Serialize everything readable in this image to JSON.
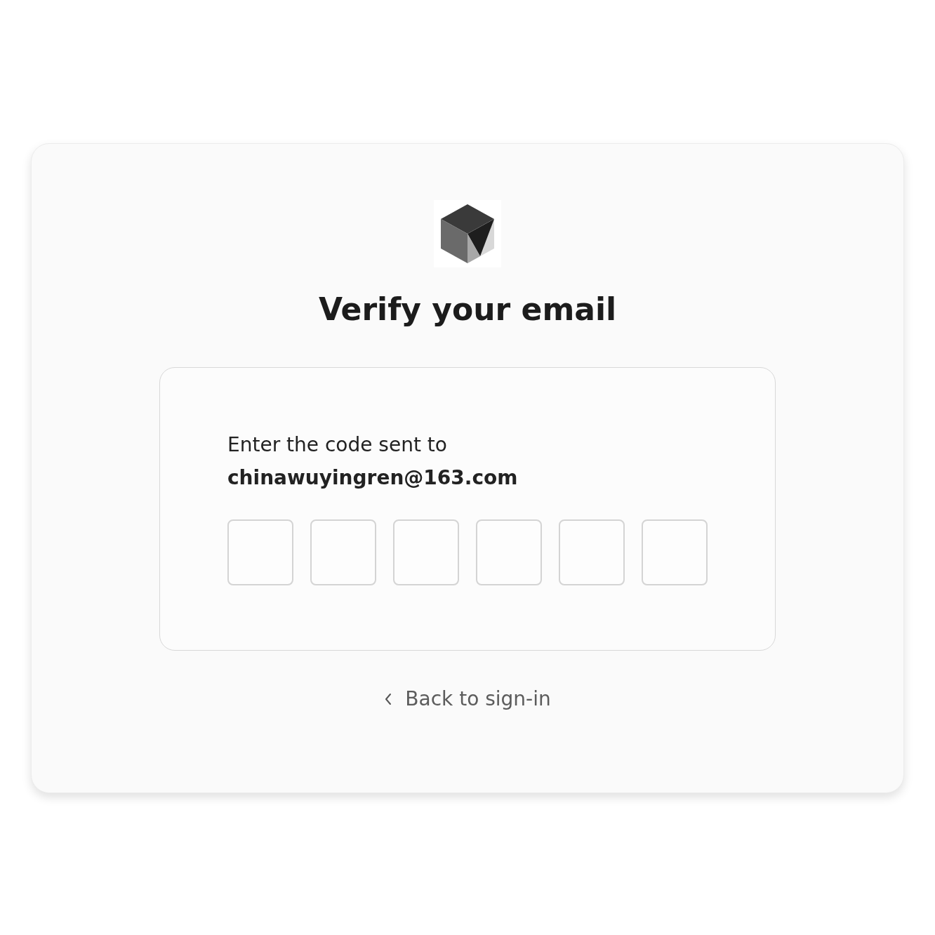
{
  "title": "Verify your email",
  "prompt": "Enter the code sent to",
  "email": "chinawuyingren@163.com",
  "code_fields": [
    {
      "focused": false
    },
    {
      "focused": false
    },
    {
      "focused": false
    },
    {
      "focused": false
    },
    {
      "focused": false
    },
    {
      "focused": false
    }
  ],
  "back_link": "Back to sign-in"
}
